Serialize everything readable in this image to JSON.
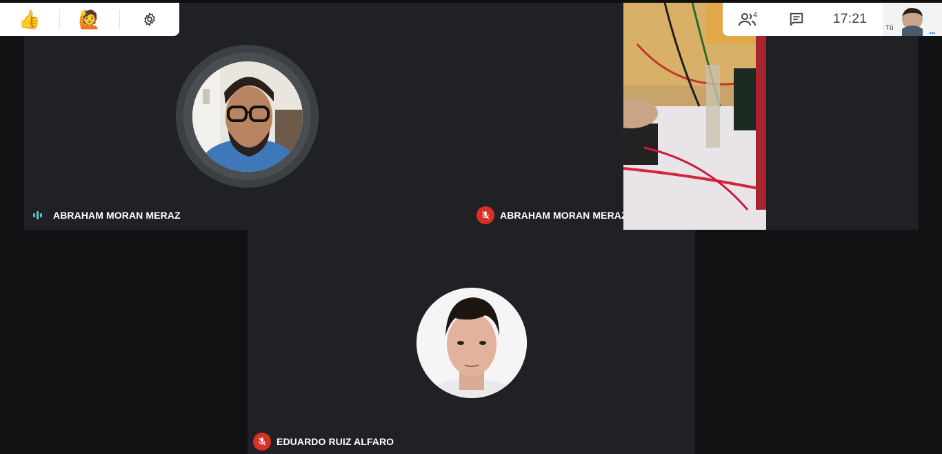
{
  "toolbar": {
    "reaction_thumbs": "👍",
    "reaction_hand": "🙋",
    "settings_icon": "gear-icon",
    "participants_count": "4",
    "clock": "17:21",
    "self_label": "Tú",
    "more_dots": "..."
  },
  "participants": [
    {
      "name": "ABRAHAM MORAN MERAZ",
      "status": "speaking"
    },
    {
      "name": "ABRAHAM MORAN MERAZ",
      "status": "muted"
    },
    {
      "name": "EDUARDO RUIZ ALFARO",
      "status": "muted"
    }
  ],
  "colors": {
    "tile_bg": "#202124",
    "page_bg": "#111213",
    "mute_red": "#d93025",
    "speaking_teal": "#4ecdc4"
  }
}
